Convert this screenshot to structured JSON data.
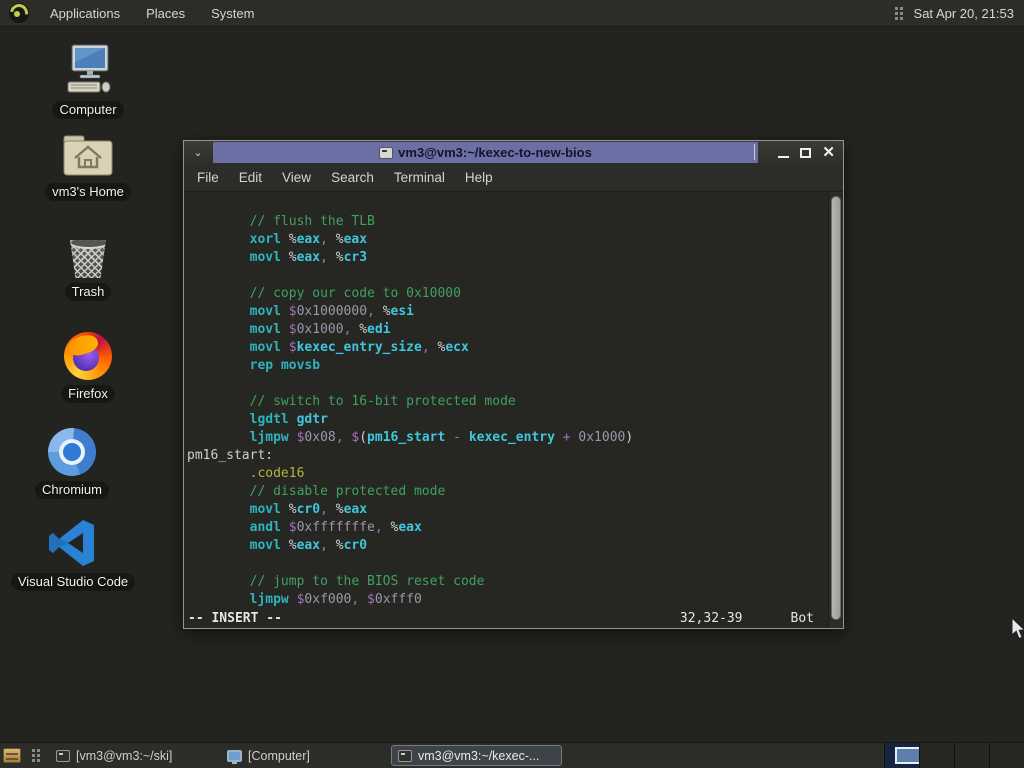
{
  "colors": {
    "titlebar-accent": "#6b6fa3",
    "workspace-active": "#17243f",
    "workspace-window": "#5b80ae"
  },
  "top_panel": {
    "menus": [
      {
        "label": "Applications"
      },
      {
        "label": "Places"
      },
      {
        "label": "System"
      }
    ],
    "clock": "Sat Apr 20, 21:53"
  },
  "desktop": {
    "icons": [
      {
        "label": "Computer"
      },
      {
        "label": "vm3's Home"
      },
      {
        "label": "Trash"
      },
      {
        "label": "Firefox"
      },
      {
        "label": "Chromium"
      },
      {
        "label": "Visual Studio Code"
      }
    ]
  },
  "terminal": {
    "title": "vm3@vm3:~/kexec-to-new-bios",
    "menu": [
      "File",
      "Edit",
      "View",
      "Search",
      "Terminal",
      "Help"
    ],
    "status": {
      "mode": "-- INSERT --",
      "position": "32,32-39",
      "scroll": "Bot"
    },
    "syntax_colors": {
      "pln": "#ccd2d4",
      "cm": "#3fa25f",
      "kw": "#2eb3bf",
      "reg": "#3fc7dc",
      "pct": "#ccd2d4",
      "pun": "#a671bb",
      "num": "#9e96a8",
      "lbl": "#ccd2d4",
      "dir": "#b3b441"
    },
    "code_lines": [
      [],
      [
        [
          "pln",
          "        "
        ],
        [
          "cm",
          "// flush the TLB"
        ]
      ],
      [
        [
          "pln",
          "        "
        ],
        [
          "kw",
          "xorl"
        ],
        [
          "pln",
          " "
        ],
        [
          "pct",
          "%"
        ],
        [
          "reg",
          "eax"
        ],
        [
          "pun",
          ","
        ],
        [
          "pln",
          " "
        ],
        [
          "pct",
          "%"
        ],
        [
          "reg",
          "eax"
        ]
      ],
      [
        [
          "pln",
          "        "
        ],
        [
          "kw",
          "movl"
        ],
        [
          "pln",
          " "
        ],
        [
          "pct",
          "%"
        ],
        [
          "reg",
          "eax"
        ],
        [
          "pun",
          ","
        ],
        [
          "pln",
          " "
        ],
        [
          "pct",
          "%"
        ],
        [
          "reg",
          "cr3"
        ]
      ],
      [],
      [
        [
          "pln",
          "        "
        ],
        [
          "cm",
          "// copy our code to 0x10000"
        ]
      ],
      [
        [
          "pln",
          "        "
        ],
        [
          "kw",
          "movl"
        ],
        [
          "pln",
          " "
        ],
        [
          "pun",
          "$"
        ],
        [
          "num",
          "0x1000000"
        ],
        [
          "pun",
          ","
        ],
        [
          "pln",
          " "
        ],
        [
          "pct",
          "%"
        ],
        [
          "reg",
          "esi"
        ]
      ],
      [
        [
          "pln",
          "        "
        ],
        [
          "kw",
          "movl"
        ],
        [
          "pln",
          " "
        ],
        [
          "pun",
          "$"
        ],
        [
          "num",
          "0x1000"
        ],
        [
          "pun",
          ","
        ],
        [
          "pln",
          " "
        ],
        [
          "pct",
          "%"
        ],
        [
          "reg",
          "edi"
        ]
      ],
      [
        [
          "pln",
          "        "
        ],
        [
          "kw",
          "movl"
        ],
        [
          "pln",
          " "
        ],
        [
          "pun",
          "$"
        ],
        [
          "reg",
          "kexec_entry_size"
        ],
        [
          "pun",
          ","
        ],
        [
          "pln",
          " "
        ],
        [
          "pct",
          "%"
        ],
        [
          "reg",
          "ecx"
        ]
      ],
      [
        [
          "pln",
          "        "
        ],
        [
          "kw",
          "rep"
        ],
        [
          "pln",
          " "
        ],
        [
          "kw",
          "movsb"
        ]
      ],
      [],
      [
        [
          "pln",
          "        "
        ],
        [
          "cm",
          "// switch to 16-bit protected mode"
        ]
      ],
      [
        [
          "pln",
          "        "
        ],
        [
          "kw",
          "lgdtl"
        ],
        [
          "pln",
          " "
        ],
        [
          "reg",
          "gdtr"
        ]
      ],
      [
        [
          "pln",
          "        "
        ],
        [
          "kw",
          "ljmpw"
        ],
        [
          "pln",
          " "
        ],
        [
          "pun",
          "$"
        ],
        [
          "num",
          "0x08"
        ],
        [
          "pun",
          ","
        ],
        [
          "pln",
          " "
        ],
        [
          "pun",
          "$"
        ],
        [
          "pln",
          "("
        ],
        [
          "reg",
          "pm16_start"
        ],
        [
          "pln",
          " "
        ],
        [
          "pun",
          "-"
        ],
        [
          "pln",
          " "
        ],
        [
          "reg",
          "kexec_entry"
        ],
        [
          "pln",
          " "
        ],
        [
          "pun",
          "+"
        ],
        [
          "pln",
          " "
        ],
        [
          "num",
          "0x1000"
        ],
        [
          "pln",
          ")"
        ]
      ],
      [
        [
          "lbl",
          "pm16_start:"
        ]
      ],
      [
        [
          "pln",
          "        "
        ],
        [
          "dir",
          ".code16"
        ]
      ],
      [
        [
          "pln",
          "        "
        ],
        [
          "cm",
          "// disable protected mode"
        ]
      ],
      [
        [
          "pln",
          "        "
        ],
        [
          "kw",
          "movl"
        ],
        [
          "pln",
          " "
        ],
        [
          "pct",
          "%"
        ],
        [
          "reg",
          "cr0"
        ],
        [
          "pun",
          ","
        ],
        [
          "pln",
          " "
        ],
        [
          "pct",
          "%"
        ],
        [
          "reg",
          "eax"
        ]
      ],
      [
        [
          "pln",
          "        "
        ],
        [
          "kw",
          "andl"
        ],
        [
          "pln",
          " "
        ],
        [
          "pun",
          "$"
        ],
        [
          "num",
          "0xfffffffe"
        ],
        [
          "pun",
          ","
        ],
        [
          "pln",
          " "
        ],
        [
          "pct",
          "%"
        ],
        [
          "reg",
          "eax"
        ]
      ],
      [
        [
          "pln",
          "        "
        ],
        [
          "kw",
          "movl"
        ],
        [
          "pln",
          " "
        ],
        [
          "pct",
          "%"
        ],
        [
          "reg",
          "eax"
        ],
        [
          "pun",
          ","
        ],
        [
          "pln",
          " "
        ],
        [
          "pct",
          "%"
        ],
        [
          "reg",
          "cr0"
        ]
      ],
      [],
      [
        [
          "pln",
          "        "
        ],
        [
          "cm",
          "// jump to the BIOS reset code"
        ]
      ],
      [
        [
          "pln",
          "        "
        ],
        [
          "kw",
          "ljmpw"
        ],
        [
          "pln",
          " "
        ],
        [
          "pun",
          "$"
        ],
        [
          "num",
          "0xf000"
        ],
        [
          "pun",
          ","
        ],
        [
          "pln",
          " "
        ],
        [
          "pun",
          "$"
        ],
        [
          "num",
          "0xfff0"
        ]
      ]
    ]
  },
  "taskbar": {
    "windows": [
      {
        "label": "[vm3@vm3:~/ski]",
        "icon": "terminal",
        "active": false
      },
      {
        "label": "[Computer]",
        "icon": "computer",
        "active": false
      },
      {
        "label": "vm3@vm3:~/kexec-...",
        "icon": "terminal",
        "active": true
      }
    ],
    "workspaces": 4,
    "active_workspace": 1
  }
}
